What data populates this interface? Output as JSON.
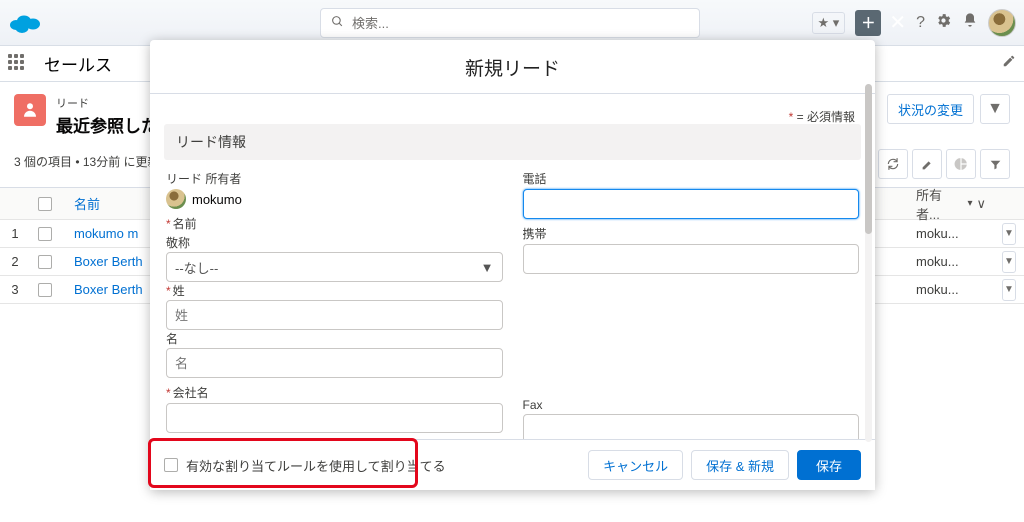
{
  "header": {
    "search_placeholder": "検索...",
    "app_name": "セールス"
  },
  "list": {
    "object": "リード",
    "view": "最近参照した",
    "meta": "3 個の項目 • 13分前 に更新さ",
    "status_change": "状況の変更",
    "columns": {
      "name": "名前",
      "owner": "所有者..."
    },
    "rows": [
      {
        "idx": "1",
        "name": "mokumo m",
        "owner": "moku..."
      },
      {
        "idx": "2",
        "name": "Boxer Berth",
        "owner": "moku..."
      },
      {
        "idx": "3",
        "name": "Boxer Berth",
        "owner": "moku..."
      }
    ]
  },
  "modal": {
    "title": "新規リード",
    "required_hint": "= 必須情報",
    "section": "リード情報",
    "fields": {
      "owner_label": "リード 所有者",
      "owner_value": "mokumo",
      "phone": "電話",
      "name": "名前",
      "mobile": "携帯",
      "salutation": "敬称",
      "salutation_value": "--なし--",
      "lastname_label": "姓",
      "lastname_ph": "姓",
      "firstname_label": "名",
      "firstname_ph": "名",
      "company": "会社名",
      "fax": "Fax"
    },
    "footer": {
      "assign_label": "有効な割り当てルールを使用して割り当てる",
      "cancel": "キャンセル",
      "save_new": "保存 & 新規",
      "save": "保存"
    }
  }
}
